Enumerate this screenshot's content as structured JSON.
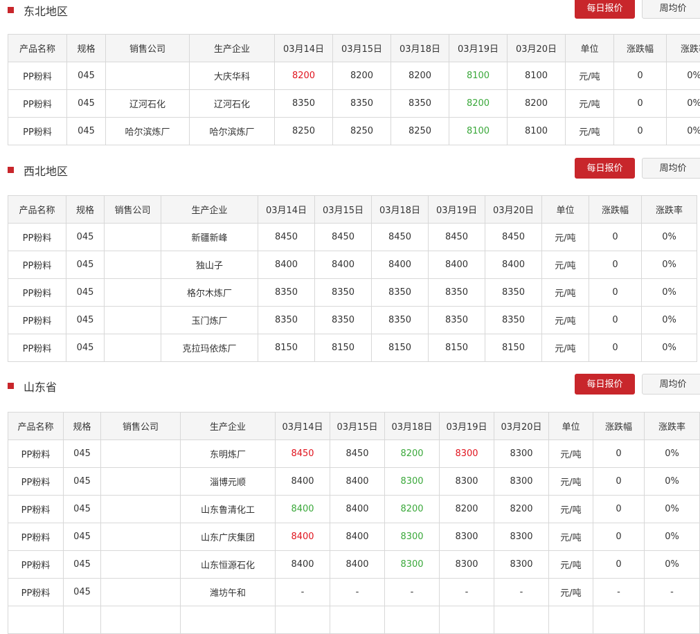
{
  "buttons": {
    "daily": "每日报价",
    "weekly": "周均价"
  },
  "sections": [
    {
      "title": "东北地区",
      "headers": [
        "产品名称",
        "规格",
        "销售公司",
        "生产企业",
        "03月14日",
        "03月15日",
        "03月18日",
        "03月19日",
        "03月20日",
        "单位",
        "涨跌幅",
        "涨跌率"
      ],
      "rows": [
        {
          "product": "PP粉料",
          "spec": "045",
          "seller": "",
          "producer": "大庆华科",
          "prices": [
            "8200",
            "8200",
            "8200",
            "8100",
            "8100"
          ],
          "trend": [
            "up",
            "",
            "",
            "down",
            ""
          ],
          "unit": "元/吨",
          "change": "0",
          "rate": "0%"
        },
        {
          "product": "PP粉料",
          "spec": "045",
          "seller": "辽河石化",
          "producer": "辽河石化",
          "prices": [
            "8350",
            "8350",
            "8350",
            "8200",
            "8200"
          ],
          "trend": [
            "",
            "",
            "",
            "down",
            ""
          ],
          "unit": "元/吨",
          "change": "0",
          "rate": "0%"
        },
        {
          "product": "PP粉料",
          "spec": "045",
          "seller": "哈尔滨炼厂",
          "producer": "哈尔滨炼厂",
          "prices": [
            "8250",
            "8250",
            "8250",
            "8100",
            "8100"
          ],
          "trend": [
            "",
            "",
            "",
            "down",
            ""
          ],
          "unit": "元/吨",
          "change": "0",
          "rate": "0%"
        }
      ]
    },
    {
      "title": "西北地区",
      "headers": [
        "产品名称",
        "规格",
        "销售公司",
        "生产企业",
        "03月14日",
        "03月15日",
        "03月18日",
        "03月19日",
        "03月20日",
        "单位",
        "涨跌幅",
        "涨跌率"
      ],
      "rows": [
        {
          "product": "PP粉料",
          "spec": "045",
          "seller": "",
          "producer": "新疆新峰",
          "prices": [
            "8450",
            "8450",
            "8450",
            "8450",
            "8450"
          ],
          "trend": [
            "",
            "",
            "",
            "",
            ""
          ],
          "unit": "元/吨",
          "change": "0",
          "rate": "0%"
        },
        {
          "product": "PP粉料",
          "spec": "045",
          "seller": "",
          "producer": "独山子",
          "prices": [
            "8400",
            "8400",
            "8400",
            "8400",
            "8400"
          ],
          "trend": [
            "",
            "",
            "",
            "",
            ""
          ],
          "unit": "元/吨",
          "change": "0",
          "rate": "0%"
        },
        {
          "product": "PP粉料",
          "spec": "045",
          "seller": "",
          "producer": "格尔木炼厂",
          "prices": [
            "8350",
            "8350",
            "8350",
            "8350",
            "8350"
          ],
          "trend": [
            "",
            "",
            "",
            "",
            ""
          ],
          "unit": "元/吨",
          "change": "0",
          "rate": "0%"
        },
        {
          "product": "PP粉料",
          "spec": "045",
          "seller": "",
          "producer": "玉门炼厂",
          "prices": [
            "8350",
            "8350",
            "8350",
            "8350",
            "8350"
          ],
          "trend": [
            "",
            "",
            "",
            "",
            ""
          ],
          "unit": "元/吨",
          "change": "0",
          "rate": "0%"
        },
        {
          "product": "PP粉料",
          "spec": "045",
          "seller": "",
          "producer": "克拉玛依炼厂",
          "prices": [
            "8150",
            "8150",
            "8150",
            "8150",
            "8150"
          ],
          "trend": [
            "",
            "",
            "",
            "",
            ""
          ],
          "unit": "元/吨",
          "change": "0",
          "rate": "0%"
        }
      ]
    },
    {
      "title": "山东省",
      "headers": [
        "产品名称",
        "规格",
        "销售公司",
        "生产企业",
        "03月14日",
        "03月15日",
        "03月18日",
        "03月19日",
        "03月20日",
        "单位",
        "涨跌幅",
        "涨跌率"
      ],
      "rows": [
        {
          "product": "PP粉料",
          "spec": "045",
          "seller": "",
          "producer": "东明炼厂",
          "prices": [
            "8450",
            "8450",
            "8200",
            "8300",
            "8300"
          ],
          "trend": [
            "up",
            "",
            "down",
            "up",
            ""
          ],
          "unit": "元/吨",
          "change": "0",
          "rate": "0%"
        },
        {
          "product": "PP粉料",
          "spec": "045",
          "seller": "",
          "producer": "淄博元顺",
          "prices": [
            "8400",
            "8400",
            "8300",
            "8300",
            "8300"
          ],
          "trend": [
            "",
            "",
            "down",
            "",
            ""
          ],
          "unit": "元/吨",
          "change": "0",
          "rate": "0%"
        },
        {
          "product": "PP粉料",
          "spec": "045",
          "seller": "",
          "producer": "山东鲁清化工",
          "prices": [
            "8400",
            "8400",
            "8200",
            "8200",
            "8200"
          ],
          "trend": [
            "down",
            "",
            "down",
            "",
            ""
          ],
          "unit": "元/吨",
          "change": "0",
          "rate": "0%"
        },
        {
          "product": "PP粉料",
          "spec": "045",
          "seller": "",
          "producer": "山东广庆集团",
          "prices": [
            "8400",
            "8400",
            "8300",
            "8300",
            "8300"
          ],
          "trend": [
            "up",
            "",
            "down",
            "",
            ""
          ],
          "unit": "元/吨",
          "change": "0",
          "rate": "0%"
        },
        {
          "product": "PP粉料",
          "spec": "045",
          "seller": "",
          "producer": "山东恒源石化",
          "prices": [
            "8400",
            "8400",
            "8300",
            "8300",
            "8300"
          ],
          "trend": [
            "",
            "",
            "down",
            "",
            ""
          ],
          "unit": "元/吨",
          "change": "0",
          "rate": "0%"
        },
        {
          "product": "PP粉料",
          "spec": "045",
          "seller": "",
          "producer": "潍坊午和",
          "prices": [
            "-",
            "-",
            "-",
            "-",
            "-"
          ],
          "trend": [
            "",
            "",
            "",
            "",
            ""
          ],
          "unit": "元/吨",
          "change": "-",
          "rate": "-"
        },
        {
          "product": "",
          "spec": "",
          "seller": "",
          "producer": "",
          "prices": [
            "",
            "",
            "",
            "",
            ""
          ],
          "trend": [
            "",
            "",
            "",
            "",
            ""
          ],
          "unit": "",
          "change": "",
          "rate": ""
        }
      ]
    }
  ]
}
